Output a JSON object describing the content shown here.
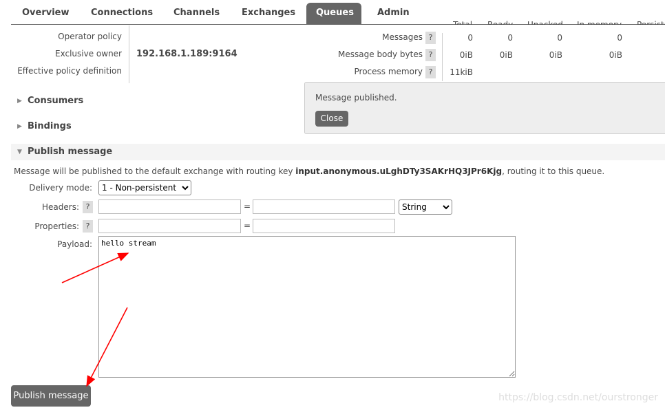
{
  "nav": {
    "tabs": [
      "Overview",
      "Connections",
      "Channels",
      "Exchanges",
      "Queues",
      "Admin"
    ],
    "active": "Queues"
  },
  "details": {
    "operator_policy": "Operator policy",
    "exclusive_owner_label": "Exclusive owner",
    "exclusive_owner": "192.168.1.189:9164",
    "effective_policy": "Effective policy definition"
  },
  "stats": {
    "headers": [
      "Total",
      "Ready",
      "Unacked",
      "In memory",
      "Persistent"
    ],
    "rows": [
      {
        "label": "Messages",
        "values": [
          "0",
          "0",
          "0",
          "0"
        ]
      },
      {
        "label": "Message body bytes",
        "values": [
          "0iB",
          "0iB",
          "0iB",
          "0iB"
        ]
      },
      {
        "label": "Process memory",
        "values": [
          "11kiB"
        ]
      }
    ],
    "help": "?"
  },
  "popup": {
    "message": "Message published.",
    "close": "Close"
  },
  "sections": {
    "consumers": "Consumers",
    "bindings": "Bindings",
    "publish": "Publish message"
  },
  "publish": {
    "intro_prefix": "Message will be published to the default exchange with routing key ",
    "routing_key": "input.anonymous.uLghDTy3SAKrHQ3JPr6Kjg",
    "intro_suffix": ", routing it to this queue.",
    "delivery_label": "Delivery mode:",
    "delivery_value": "1 - Non-persistent",
    "headers_label": "Headers:",
    "properties_label": "Properties:",
    "eq": "=",
    "type_value": "String",
    "payload_label": "Payload:",
    "payload": "hello stream",
    "button": "Publish message"
  },
  "watermark": "https://blog.csdn.net/ourstronger",
  "colors": {
    "accent": "#666666",
    "arrow": "#ff0000"
  }
}
